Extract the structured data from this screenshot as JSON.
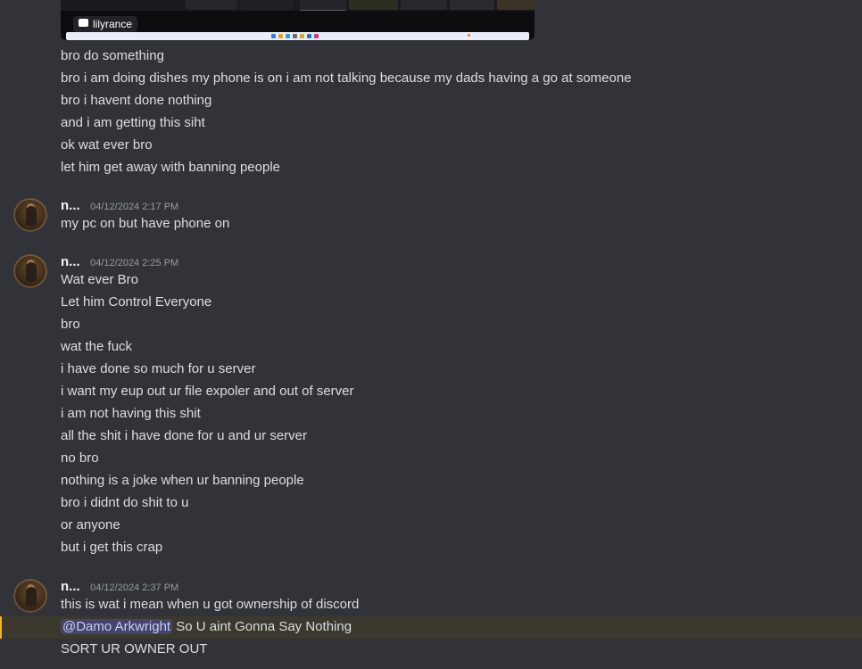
{
  "attachment": {
    "label": "lilyrance",
    "icon": "monitor-icon"
  },
  "groups": [
    {
      "author": null,
      "lines": [
        "bro do something",
        "bro i am doing dishes my phone is on i am not talking because my dads having a go at someone",
        "bro i havent done nothing",
        "and i am getting this siht",
        "ok wat ever bro",
        "let him get away with banning people"
      ]
    },
    {
      "author": "n...",
      "timestamp": "04/12/2024 2:17 PM",
      "lines": [
        "my pc on but have phone on"
      ]
    },
    {
      "author": "n...",
      "timestamp": "04/12/2024 2:25 PM",
      "lines": [
        "Wat ever Bro",
        "Let him Control Everyone",
        "bro",
        "wat the fuck",
        "i have done so much for u server",
        "i want my eup out ur file expoler and out of server",
        "i am not having this shit",
        "all the shit i have done for u and ur server",
        "no bro",
        "nothing is a joke when ur banning people",
        "bro i didnt do shit to u",
        "or anyone",
        "but i get this crap"
      ]
    },
    {
      "author": "n...",
      "timestamp": "04/12/2024 2:37 PM",
      "lines": [
        "this is wat i mean when u got ownership of discord",
        "So U aint Gonna Say Nothing",
        "SORT UR OWNER OUT"
      ],
      "mention": "@Damo Arkwright"
    }
  ],
  "colors": {
    "background": "#313338",
    "text": "#dbdee1",
    "mention_bg": "#3b382e",
    "mention_bar": "#f0b232",
    "mention_pill": "#5865f2"
  }
}
